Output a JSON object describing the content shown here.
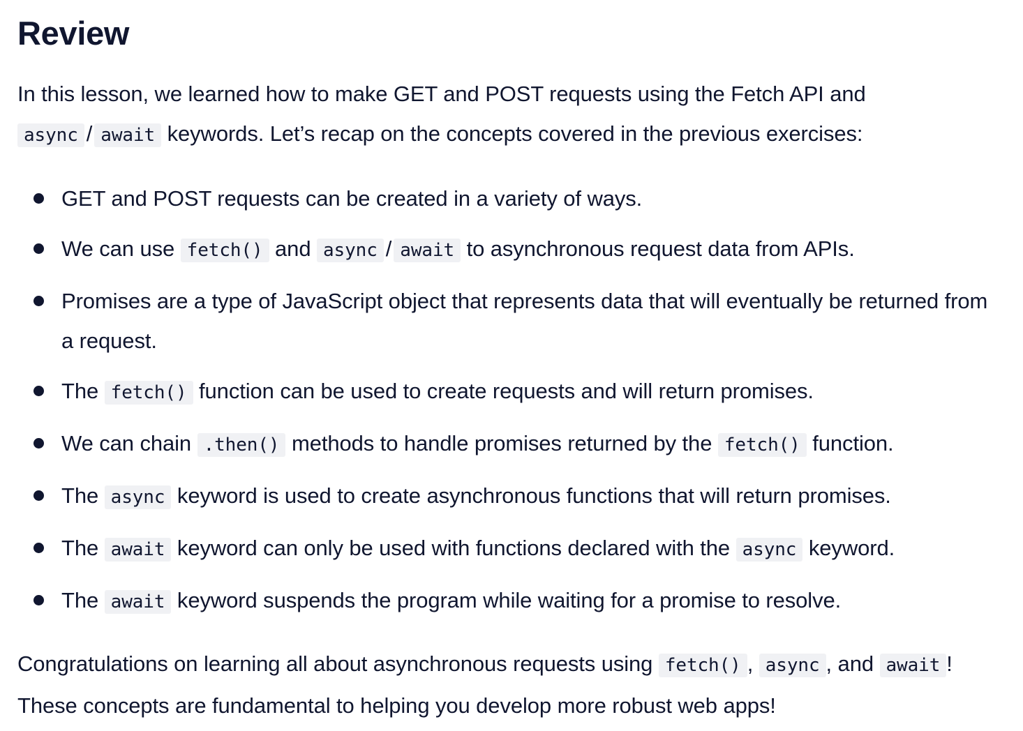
{
  "title": "Review",
  "intro": {
    "t1": "In this lesson, we learned how to make GET and POST requests using the Fetch API and ",
    "c1": "async",
    "slash": "/",
    "c2": "await",
    "t2": " keywords. Let’s recap on the concepts covered in the previous exercises:"
  },
  "bullets": {
    "b0": {
      "t1": "GET and POST requests can be created in a variety of ways."
    },
    "b1": {
      "t1": "We can use ",
      "c1": "fetch()",
      "t2": " and ",
      "c2": "async",
      "slash": "/",
      "c3": "await",
      "t3": " to asynchronous request data from APIs."
    },
    "b2": {
      "t1": "Promises are a type of JavaScript object that represents data that will eventually be returned from a request."
    },
    "b3": {
      "t1": "The ",
      "c1": "fetch()",
      "t2": " function can be used to create requests and will return promises."
    },
    "b4": {
      "t1": "We can chain ",
      "c1": ".then()",
      "t2": " methods to handle promises returned by the ",
      "c2": "fetch()",
      "t3": " function."
    },
    "b5": {
      "t1": "The ",
      "c1": "async",
      "t2": " keyword is used to create asynchronous functions that will return promises."
    },
    "b6": {
      "t1": "The ",
      "c1": "await",
      "t2": " keyword can only be used with functions declared with the ",
      "c2": "async",
      "t3": " keyword."
    },
    "b7": {
      "t1": "The ",
      "c1": "await",
      "t2": " keyword suspends the program while waiting for a promise to resolve."
    }
  },
  "outro": {
    "t1": "Congratulations on learning all about asynchronous requests using ",
    "c1": "fetch()",
    "t2": ", ",
    "c2": "async",
    "t3": ", and ",
    "c3": "await",
    "t4": "! These concepts are fundamental to helping you develop more robust web apps!"
  }
}
